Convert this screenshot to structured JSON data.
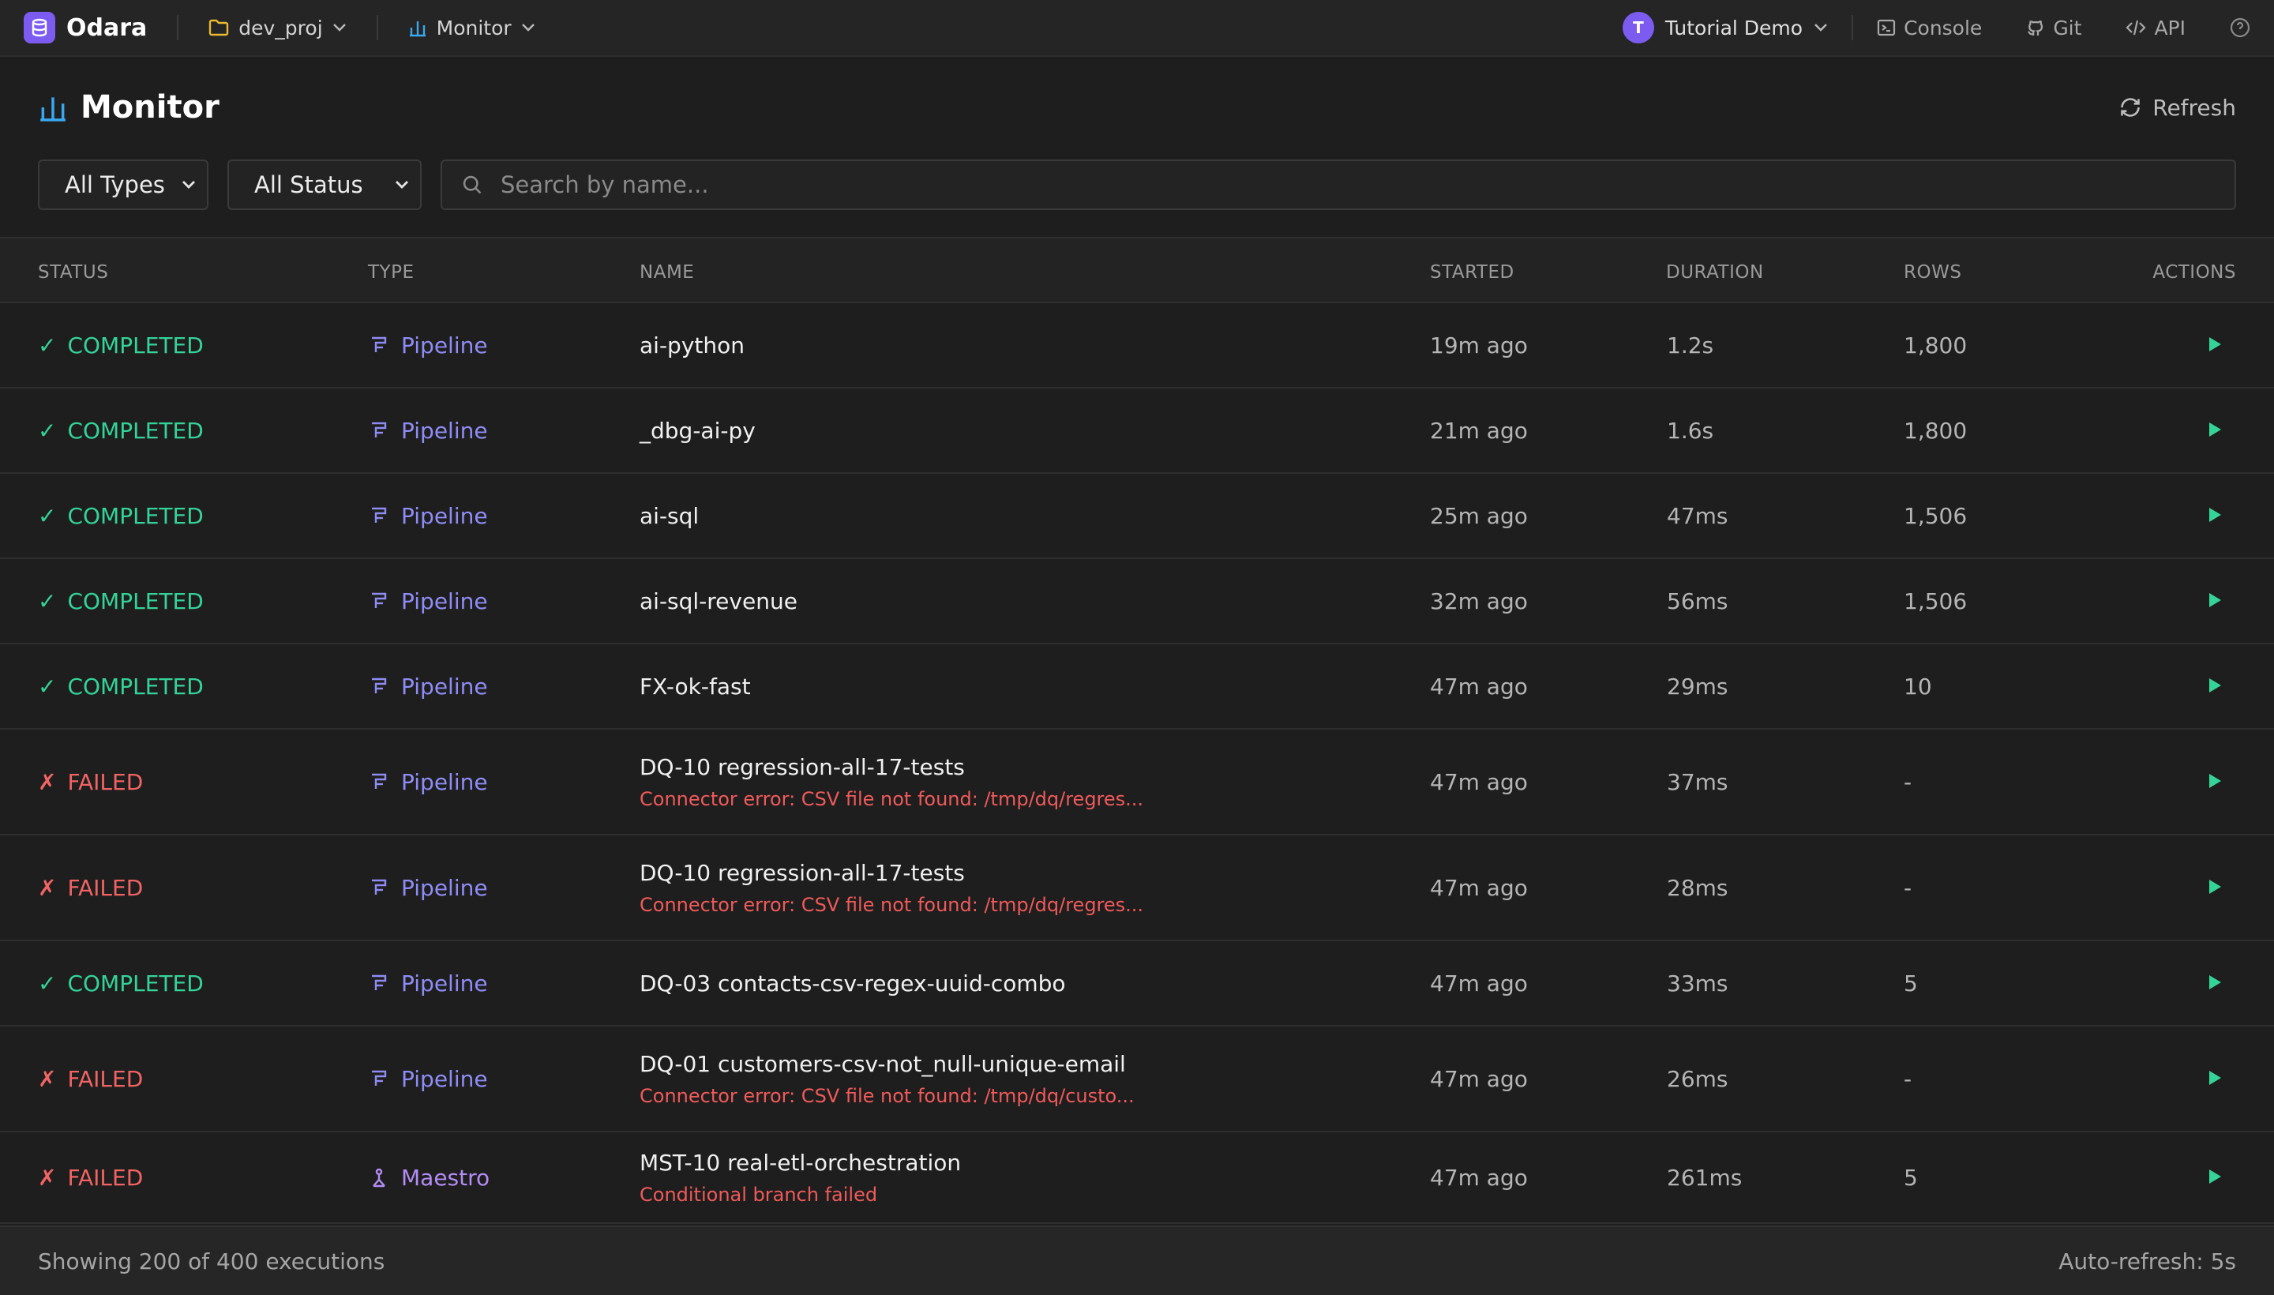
{
  "topbar": {
    "brand": "Odara",
    "project": "dev_proj",
    "section": "Monitor",
    "user_initial": "T",
    "user_name": "Tutorial Demo",
    "links": {
      "console": "Console",
      "git": "Git",
      "api": "API"
    }
  },
  "page": {
    "title": "Monitor",
    "refresh_label": "Refresh"
  },
  "filters": {
    "type_options": [
      "All Types"
    ],
    "type_selected": "All Types",
    "status_options": [
      "All Status"
    ],
    "status_selected": "All Status",
    "search_placeholder": "Search by name..."
  },
  "table": {
    "headers": {
      "status": "STATUS",
      "type": "TYPE",
      "name": "NAME",
      "started": "STARTED",
      "duration": "DURATION",
      "rows": "ROWS",
      "actions": "ACTIONS"
    },
    "rows": [
      {
        "status": "COMPLETED",
        "type": "Pipeline",
        "name": "ai-python",
        "error": "",
        "started": "19m ago",
        "duration": "1.2s",
        "rows": "1,800"
      },
      {
        "status": "COMPLETED",
        "type": "Pipeline",
        "name": "_dbg-ai-py",
        "error": "",
        "started": "21m ago",
        "duration": "1.6s",
        "rows": "1,800"
      },
      {
        "status": "COMPLETED",
        "type": "Pipeline",
        "name": "ai-sql",
        "error": "",
        "started": "25m ago",
        "duration": "47ms",
        "rows": "1,506"
      },
      {
        "status": "COMPLETED",
        "type": "Pipeline",
        "name": "ai-sql-revenue",
        "error": "",
        "started": "32m ago",
        "duration": "56ms",
        "rows": "1,506"
      },
      {
        "status": "COMPLETED",
        "type": "Pipeline",
        "name": "FX-ok-fast",
        "error": "",
        "started": "47m ago",
        "duration": "29ms",
        "rows": "10"
      },
      {
        "status": "FAILED",
        "type": "Pipeline",
        "name": "DQ-10 regression-all-17-tests",
        "error": "Connector error: CSV file not found: /tmp/dq/regres...",
        "started": "47m ago",
        "duration": "37ms",
        "rows": "-"
      },
      {
        "status": "FAILED",
        "type": "Pipeline",
        "name": "DQ-10 regression-all-17-tests",
        "error": "Connector error: CSV file not found: /tmp/dq/regres...",
        "started": "47m ago",
        "duration": "28ms",
        "rows": "-"
      },
      {
        "status": "COMPLETED",
        "type": "Pipeline",
        "name": "DQ-03 contacts-csv-regex-uuid-combo",
        "error": "",
        "started": "47m ago",
        "duration": "33ms",
        "rows": "5"
      },
      {
        "status": "FAILED",
        "type": "Pipeline",
        "name": "DQ-01 customers-csv-not_null-unique-email",
        "error": "Connector error: CSV file not found: /tmp/dq/custo...",
        "started": "47m ago",
        "duration": "26ms",
        "rows": "-"
      },
      {
        "status": "FAILED",
        "type": "Maestro",
        "name": "MST-10 real-etl-orchestration",
        "error": "Conditional branch failed",
        "started": "47m ago",
        "duration": "261ms",
        "rows": "5"
      }
    ]
  },
  "footer": {
    "summary": "Showing 200 of 400 executions",
    "auto_refresh": "Auto-refresh: 5s"
  },
  "colors": {
    "accent": "#7c5cf0",
    "success": "#34d399",
    "error": "#f26464",
    "pipeline": "#8f8cf5",
    "maestro": "#b48cf5",
    "folder": "#e8b931",
    "monitor": "#3aa8f0"
  }
}
